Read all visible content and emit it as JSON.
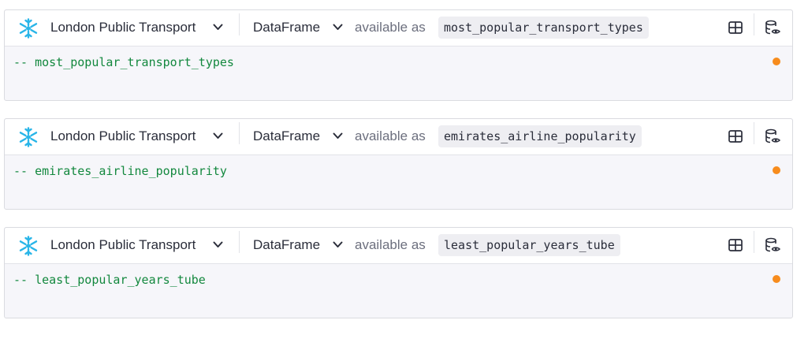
{
  "cells": [
    {
      "connection": "London Public Transport",
      "output_type": "DataFrame",
      "available_label": "available as",
      "variable": "most_popular_transport_types",
      "code": "-- most_popular_transport_types"
    },
    {
      "connection": "London Public Transport",
      "output_type": "DataFrame",
      "available_label": "available as",
      "variable": "emirates_airline_popularity",
      "code": "-- emirates_airline_popularity"
    },
    {
      "connection": "London Public Transport",
      "output_type": "DataFrame",
      "available_label": "available as",
      "variable": "least_popular_years_tube",
      "code": "-- least_popular_years_tube"
    }
  ],
  "icons": {
    "connection": "snowflake-icon",
    "dropdown": "chevron-down-icon",
    "table_view": "table-icon",
    "database_view": "database-eye-icon",
    "status": "status-dot-icon"
  },
  "colors": {
    "snowflake": "#29b5e8",
    "code": "#13883e",
    "status_dot": "#f78c1d"
  }
}
